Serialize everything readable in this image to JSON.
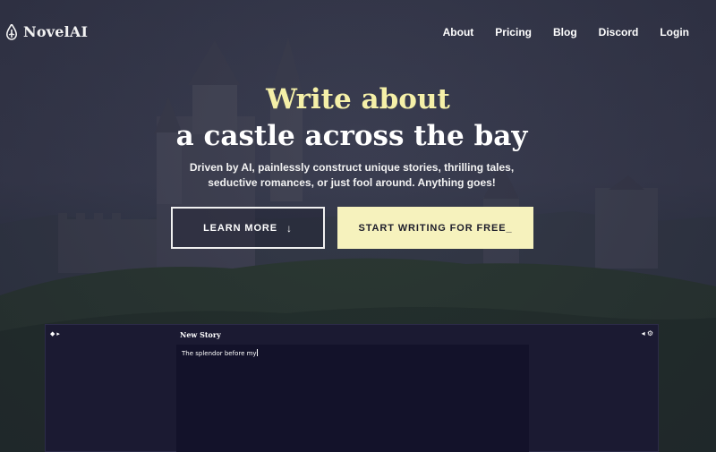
{
  "brand": {
    "name": "NovelAI",
    "icon": "quill-icon"
  },
  "nav": {
    "items": [
      {
        "label": "About"
      },
      {
        "label": "Pricing"
      },
      {
        "label": "Blog"
      },
      {
        "label": "Discord"
      },
      {
        "label": "Login"
      }
    ]
  },
  "hero": {
    "title_line1": "Write about",
    "title_line2": "a castle across the bay",
    "subtitle_line1": "Driven by AI, painlessly construct unique stories, thrilling tales,",
    "subtitle_line2": "seductive romances, or just fool around. Anything goes!",
    "learn_more_label": "LEARN MORE",
    "learn_more_icon": "arrow-down-icon",
    "start_label": "START WRITING FOR FREE_"
  },
  "editor": {
    "title": "New Story",
    "text": "The splendor before my",
    "left_controls": "◆ ▸",
    "right_controls": "◂ ⚙"
  },
  "colors": {
    "accent_yellow": "#f5f0a8",
    "button_fill": "#f6f2bd",
    "editor_bg": "#1b1a32",
    "editor_panel": "#13122a"
  }
}
